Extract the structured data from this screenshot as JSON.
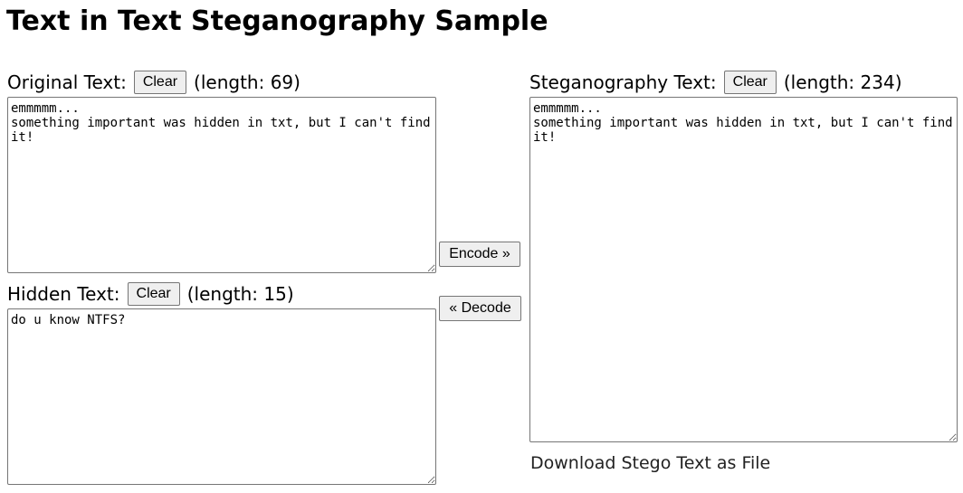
{
  "title": "Text in Text Steganography Sample",
  "original": {
    "label": "Original Text:",
    "clear_label": "Clear",
    "length_text": "(length: 69)",
    "value": "emmmmm...\nsomething important was hidden in txt, but I can't find it!"
  },
  "hidden": {
    "label": "Hidden Text:",
    "clear_label": "Clear",
    "length_text": "(length: 15)",
    "value": "do u know NTFS?"
  },
  "stego": {
    "label": "Steganography Text:",
    "clear_label": "Clear",
    "length_text": "(length: 234)",
    "value": "emmmmm...\nsomething important was hidden in txt, but I can't find it!"
  },
  "actions": {
    "encode_label": "Encode »",
    "decode_label": "« Decode"
  },
  "download": {
    "label": "Download Stego Text as File"
  }
}
